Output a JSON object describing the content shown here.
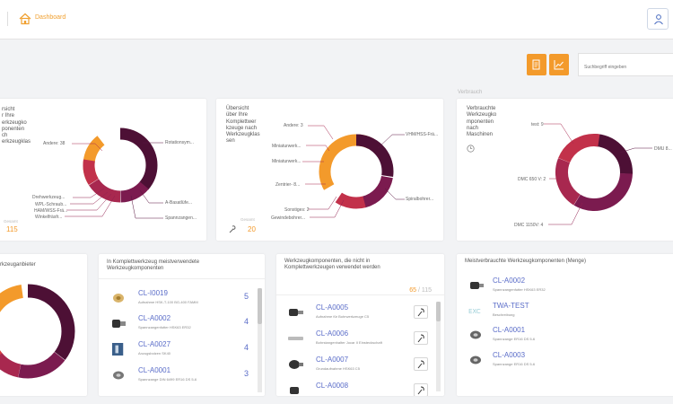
{
  "header": {
    "breadcrumb": "Dashboard"
  },
  "search": {
    "placeholder": "Suchbegriff eingeben"
  },
  "sections": {
    "verbrauch": "Verbrauch"
  },
  "cards": {
    "werkzeugklasse": {
      "title_lines": [
        "rsicht",
        "r Ihre",
        "erkzeugko",
        "ponenten",
        "ch",
        "erkzeugklas"
      ],
      "labels": [
        "Andere: 38",
        "Rotationsym...",
        "Drehwerkzeug...",
        "WPL-Schraub...",
        "HAM/WSS-Frä...",
        "Winkelfräsfr...",
        "A-Basatlüfe...",
        "Spannzangen..."
      ],
      "count_label": "Gesamt",
      "count": "115"
    },
    "komplettwerkzeuge": {
      "title_lines": [
        "Übersicht",
        "über Ihre",
        "Komplettwer",
        "kzeuge nach",
        "Werkzeugklas",
        "sen"
      ],
      "labels": [
        "Andere: 3",
        "Miniaturwerk...",
        "Miniaturwerk...",
        "Zentrier- 8...",
        "Sonstiges: 2",
        "Gewindebohrer...",
        "VHM/HSS-Frä...",
        "Spiralbohrer..."
      ],
      "count_label": "Gesamt",
      "count": "20"
    },
    "maschinen": {
      "title_lines": [
        "Verbrauchte",
        "Werkzeugko",
        "mponenten",
        "nach",
        "Maschinen"
      ],
      "labels": [
        "test: 9",
        "DMU 8...",
        "DMC 650 V: 2",
        "DMC 1150V: 4"
      ]
    },
    "anbieter": {
      "title": "rkzeuganbieter"
    },
    "meistverwendet": {
      "title_lines": [
        "In Komplettwerkzeug meistverwendete",
        "Werkzeugkomponenten"
      ],
      "items": [
        {
          "code": "CL-I0019",
          "desc": "Aufnahme HSK-T-100 BG-400 FAMM",
          "num": "5"
        },
        {
          "code": "CL-A0002",
          "desc": "Spannzangenfutter HSK63 ER32",
          "num": "4"
        },
        {
          "code": "CL-A0027",
          "desc": "Anzugsbolzen SK40",
          "num": "4"
        },
        {
          "code": "CL-A0001",
          "desc": "Spannzange DIN 6499 ER16 DS 5-6",
          "num": "3"
        }
      ]
    },
    "nichtverwendet": {
      "title_lines": [
        "Werkzeugkomponenten, die nicht in",
        "Komplettwerkzeugen verwendet werden"
      ],
      "count_a": "65",
      "count_b": "/ 115",
      "items": [
        {
          "code": "CL-A0005",
          "desc": "Aufnahme für Bohrwerkzeuge C5"
        },
        {
          "code": "CL-A0006",
          "desc": "Bohrstangenhalter Jocar II Einsteckschaft"
        },
        {
          "code": "CL-A0007",
          "desc": "Grundaufnahme HSK63 C5"
        },
        {
          "code": "CL-A0008",
          "desc": ""
        }
      ]
    },
    "menge": {
      "title": "Meistverbrauchte Werkzeugkomponenten (Menge)",
      "items": [
        {
          "code": "CL-A0002",
          "desc": "Spannzangenfutter HSK63 ER32"
        },
        {
          "code": "TWA-TEST",
          "desc": "Beschreibung"
        },
        {
          "code": "CL-A0001",
          "desc": "Spannzange ER16 DS 5-6"
        },
        {
          "code": "CL-A0003",
          "desc": "Spannzange ER16 DS 5-6"
        }
      ]
    }
  },
  "colors": {
    "accent": "#f39a2b",
    "link": "#5a6cc8",
    "donut": [
      "#f39a2b",
      "#4d1035",
      "#631744",
      "#7b1b4f",
      "#92204f",
      "#a8284f",
      "#c2314a",
      "#d53f41"
    ]
  }
}
